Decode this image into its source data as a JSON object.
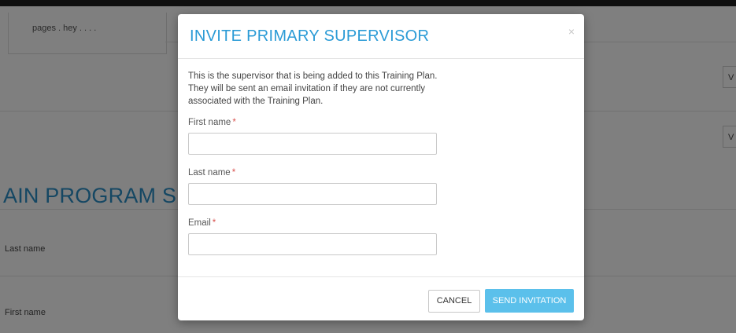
{
  "background": {
    "card_text": "pages . hey . . . .",
    "row_buttons": [
      "V",
      "V"
    ],
    "section_heading": "AIN PROGRAM SU",
    "rows": [
      {
        "label": "Last name"
      },
      {
        "label": "First name"
      }
    ]
  },
  "modal": {
    "title": "INVITE PRIMARY SUPERVISOR",
    "close_symbol": "×",
    "description_lines": [
      "This is the supervisor that is being added to this Training Plan.",
      "They will be sent an email invitation if they are not currently",
      "associated with the Training Plan."
    ],
    "fields": [
      {
        "label": "First name",
        "required_mark": "*",
        "value": "",
        "placeholder": ""
      },
      {
        "label": "Last name",
        "required_mark": "*",
        "value": "",
        "placeholder": ""
      },
      {
        "label": "Email",
        "required_mark": "*",
        "value": "",
        "placeholder": ""
      }
    ],
    "cancel_label": "CANCEL",
    "send_label": "SEND INVITATION"
  },
  "colors": {
    "accent": "#2b9bd6",
    "button_primary": "#5bc0eb",
    "required": "#d9534f",
    "overlay": "rgba(0,0,0,0.5)"
  }
}
